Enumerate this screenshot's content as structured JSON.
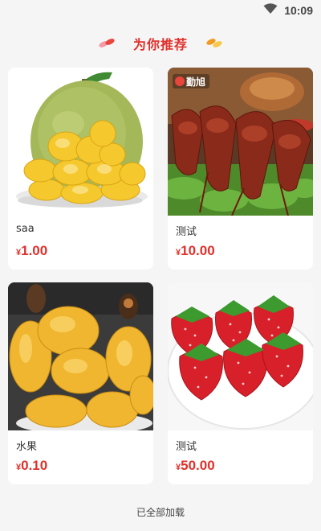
{
  "status_bar": {
    "time": "10:09",
    "icons": [
      "wifi-icon"
    ]
  },
  "section": {
    "title": "为你推荐",
    "accent_color": "#e0302b"
  },
  "products": [
    {
      "name": "saa",
      "currency": "¥",
      "price": "1.00",
      "image": "jackfruit-whole"
    },
    {
      "name": "测试",
      "currency": "¥",
      "price": "10.00",
      "image": "crayfish-dish",
      "image_logo_text": "勤旭"
    },
    {
      "name": "水果",
      "currency": "¥",
      "price": "0.10",
      "image": "jackfruit-pulp"
    },
    {
      "name": "测试",
      "currency": "¥",
      "price": "50.00",
      "image": "strawberries"
    }
  ],
  "footer": {
    "load_status": "已全部加载"
  }
}
